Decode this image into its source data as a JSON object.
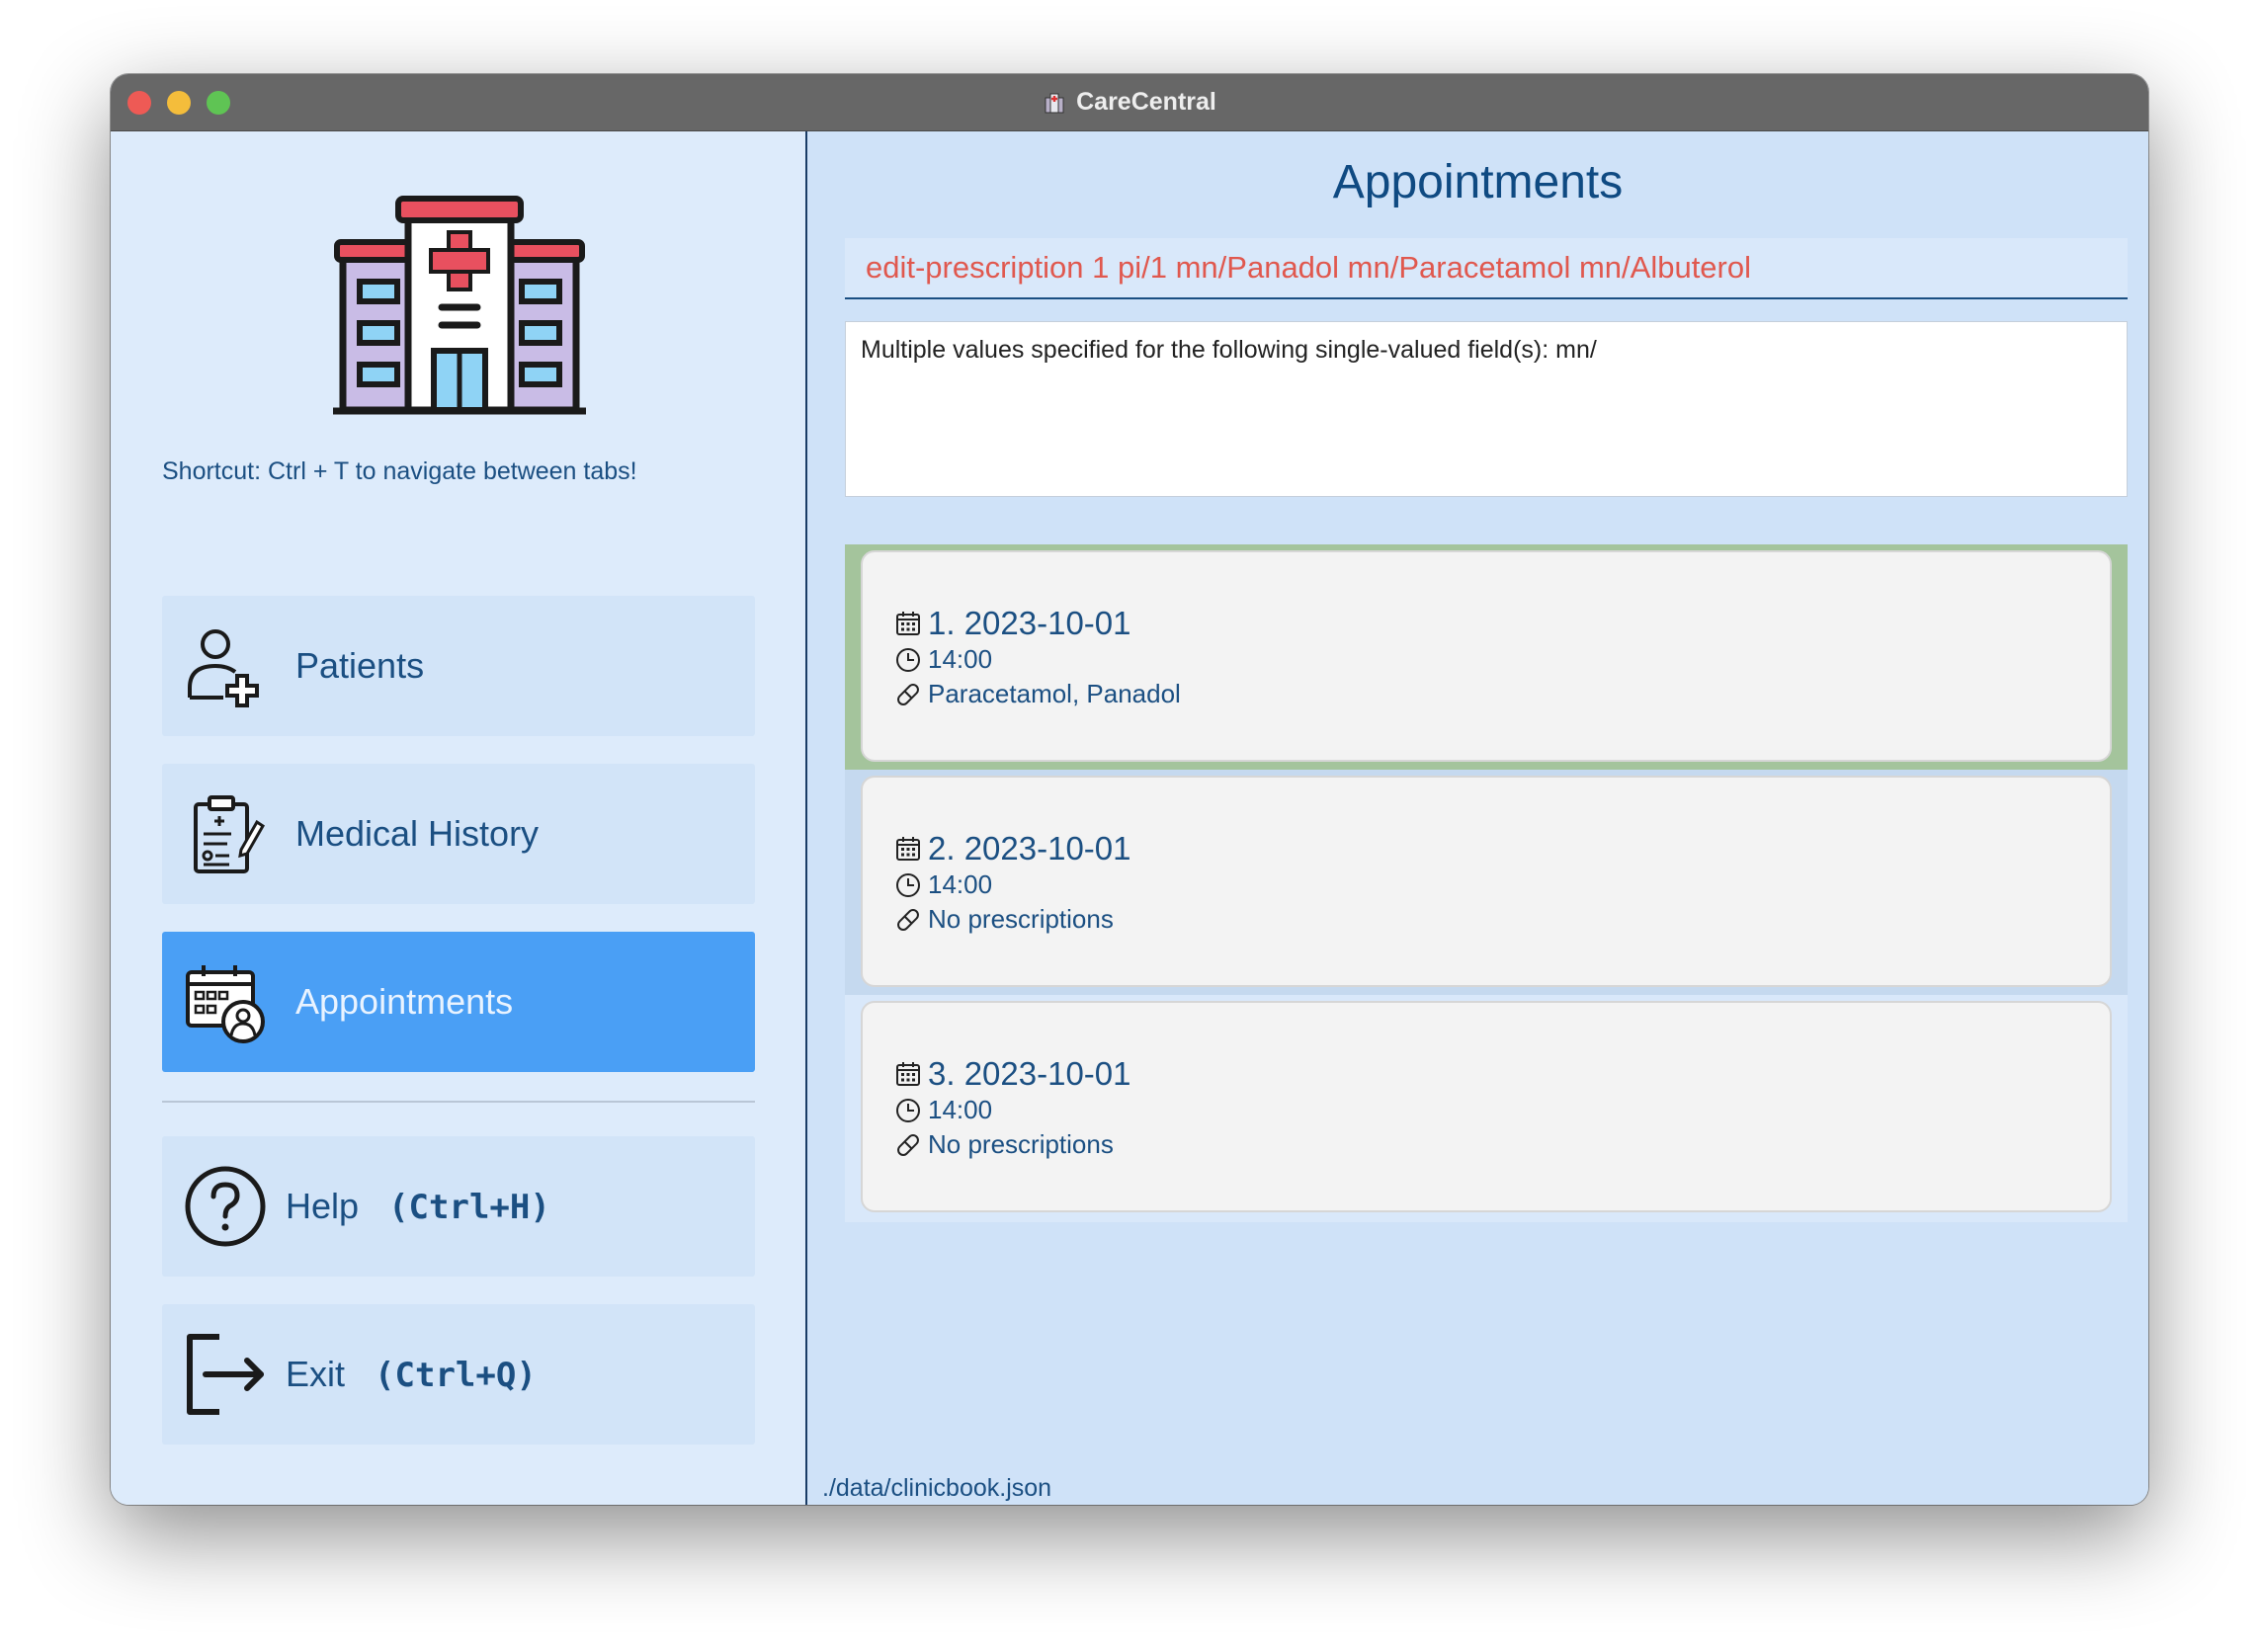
{
  "window": {
    "title": "CareCentral"
  },
  "sidebar": {
    "shortcut_hint": "Shortcut: Ctrl + T to navigate between tabs!",
    "nav": [
      {
        "label": "Patients",
        "icon": "add-user-icon",
        "active": false
      },
      {
        "label": "Medical History",
        "icon": "clipboard-icon",
        "active": false
      },
      {
        "label": "Appointments",
        "icon": "calendar-person-icon",
        "active": true
      }
    ],
    "help": {
      "label": "Help",
      "shortcut": "(Ctrl+H)"
    },
    "exit": {
      "label": "Exit",
      "shortcut": "(Ctrl+Q)"
    }
  },
  "main": {
    "title": "Appointments",
    "command": "edit-prescription 1 pi/1 mn/Panadol mn/Paracetamol mn/Albuterol",
    "result": "Multiple values specified for the following single-valued field(s): mn/",
    "appointments": [
      {
        "heading": "1. 2023-10-01",
        "time": "14:00",
        "prescriptions": "Paracetamol, Panadol"
      },
      {
        "heading": "2. 2023-10-01",
        "time": "14:00",
        "prescriptions": "No prescriptions"
      },
      {
        "heading": "3. 2023-10-01",
        "time": "14:00",
        "prescriptions": "No prescriptions"
      }
    ],
    "status_path": "./data/clinicbook.json"
  },
  "colors": {
    "accent": "#4a9ff5",
    "error_text": "#e0584e",
    "selected_row": "#a4c49c",
    "text_primary": "#1b4f82"
  }
}
